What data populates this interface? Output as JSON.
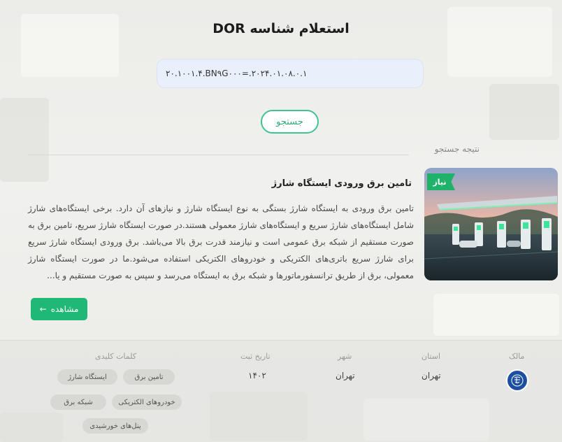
{
  "title": "استعلام شناسه DOR",
  "search": {
    "value": "۲۰.۱۰۰۱.۴.BN۹G۰۰۰=.۲۰۲۴.۰۱.۰۸.۰.۱",
    "button_label": "جستجو"
  },
  "results_label": "نتیجه جستجو",
  "card": {
    "badge": "نیاز",
    "title": "تامین برق ورودی ایستگاه شارژ",
    "description": "تامین برق ورودی به ایستگاه شارژ بستگی به نوع ایستگاه شارژ و نیازهای آن دارد. برخی ایستگاه‌های شارژ شامل ایستگاه‌های شارژ سریع و ایستگاه‌های شارژ معمولی هستند.در صورت ایستگاه شارژ سریع، تامین برق به صورت مستقیم از شبکه برق عمومی است و نیازمند قدرت برق بالا می‌باشد. برق ورودی ایستگاه شارژ سریع برای شارژ سریع باتری‌های الکتریکی و خودروهای الکتریکی استفاده می‌شود.ما در صورت ایستگاه شارژ معمولی، برق از طریق ترانسفورماتورها و شبکه برق به ایستگاه می‌رسد و سپس به صورت مستقیم و یا...",
    "view_label": "مشاهده",
    "view_arrow": "←"
  },
  "info": {
    "owner_label": "مالک",
    "province_label": "استان",
    "province_value": "تهران",
    "city_label": "شهر",
    "city_value": "تهران",
    "date_label": "تاریخ ثبت",
    "date_value": "۱۴۰۲",
    "keywords_label": "کلمات کلیدی",
    "keywords": [
      "تامین برق",
      "ایستگاه شارژ",
      "خودروهای الکتریکی",
      "شبکه برق",
      "پنل‌های خورشیدی"
    ]
  },
  "colors": {
    "accent": "#1fb877",
    "outline": "#40c392",
    "owner_logo": "#1d4fa0"
  }
}
